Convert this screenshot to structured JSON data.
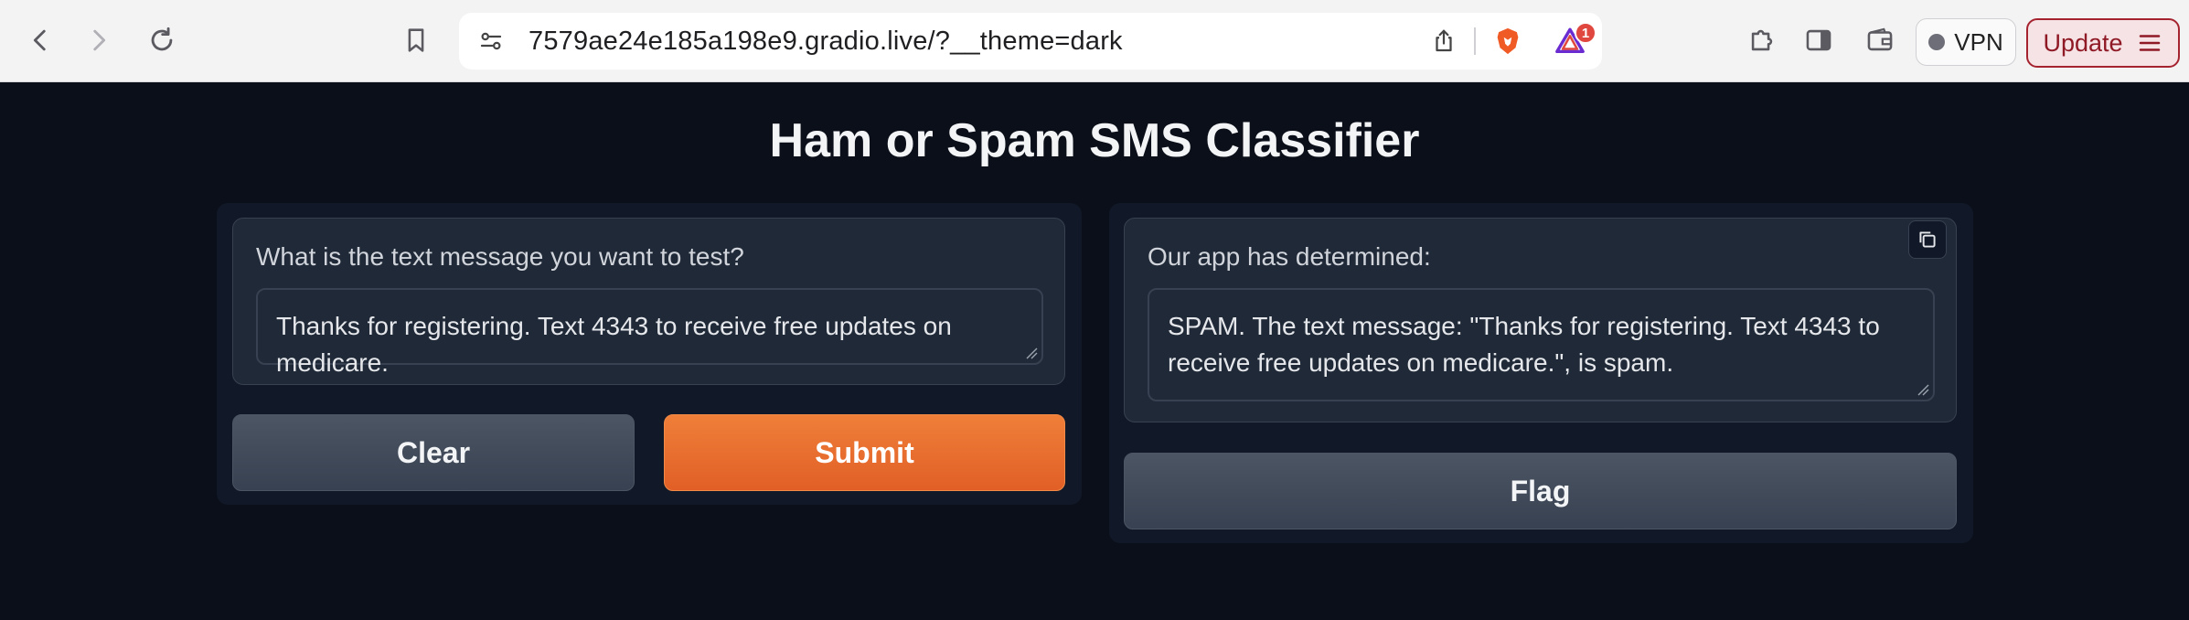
{
  "browser": {
    "url": "7579ae24e185a198e9.gradio.live/?__theme=dark",
    "vpn_label": "VPN",
    "update_label": "Update",
    "notification_count": "1"
  },
  "app": {
    "title": "Ham or Spam SMS Classifier",
    "input": {
      "label": "What is the text message you want to test?",
      "value": "Thanks for registering. Text 4343 to receive free updates on medicare."
    },
    "output": {
      "label": "Our app has determined:",
      "value": "SPAM. The text message: \"Thanks for registering. Text 4343 to receive free updates on medicare.\", is spam."
    },
    "buttons": {
      "clear": "Clear",
      "submit": "Submit",
      "flag": "Flag"
    }
  },
  "colors": {
    "background": "#0b0f19",
    "primary": "#e8692d",
    "panel": "#111827",
    "block": "#1f2937"
  }
}
